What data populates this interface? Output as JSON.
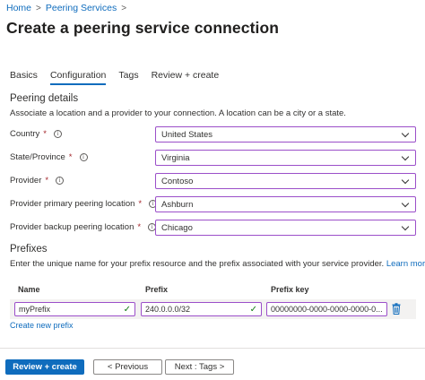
{
  "breadcrumb": {
    "home": "Home",
    "sep": ">",
    "peering_services": "Peering Services"
  },
  "page": {
    "title": "Create a peering service connection",
    "more": "···"
  },
  "tabs": [
    {
      "label": "Basics",
      "active": false
    },
    {
      "label": "Configuration",
      "active": true
    },
    {
      "label": "Tags",
      "active": false
    },
    {
      "label": "Review + create",
      "active": false
    }
  ],
  "peering_details": {
    "title": "Peering details",
    "description": "Associate a location and a provider to your connection. A location can be a city or a state.",
    "fields": [
      {
        "label": "Country",
        "required": true,
        "value": "United States"
      },
      {
        "label": "State/Province",
        "required": true,
        "value": "Virginia"
      },
      {
        "label": "Provider",
        "required": true,
        "value": "Contoso"
      },
      {
        "label": "Provider primary peering location",
        "required": true,
        "value": "Ashburn"
      },
      {
        "label": "Provider backup peering location",
        "required": true,
        "value": "Chicago"
      }
    ]
  },
  "prefixes": {
    "title": "Prefixes",
    "description": "Enter the unique name for your prefix resource and the prefix associated with your service provider.",
    "learn_more": "Learn more",
    "columns": {
      "name": "Name",
      "prefix": "Prefix",
      "prefix_key": "Prefix key"
    },
    "row": {
      "name": "myPrefix",
      "prefix": "240.0.0.0/32",
      "prefix_key": "00000000-0000-0000-0000-0..."
    },
    "create_new": "Create new prefix"
  },
  "footer": {
    "review_create": "Review + create",
    "previous": "< Previous",
    "next": "Next : Tags >"
  },
  "colors": {
    "accent": "#0f6cbd",
    "input_border": "#9b4fc9",
    "required": "#a4262c",
    "valid": "#107c10"
  }
}
